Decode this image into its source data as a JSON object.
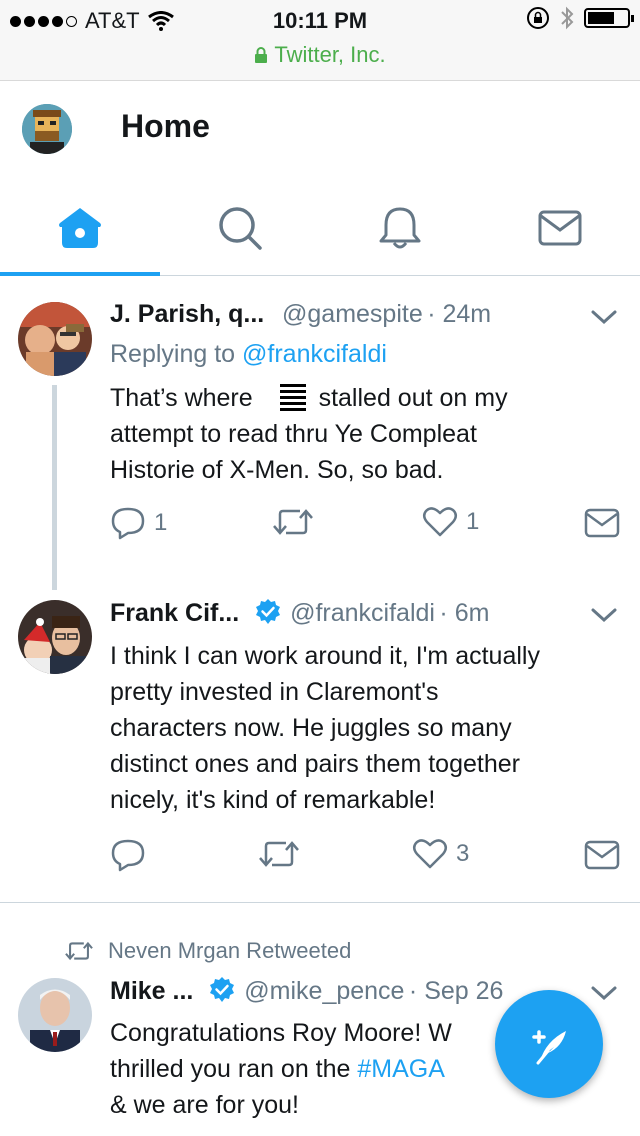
{
  "status_bar": {
    "carrier": "AT&T",
    "time": "10:11 PM",
    "url": "Twitter, Inc."
  },
  "header": {
    "title": "Home"
  },
  "tabs": [
    {
      "name": "home",
      "active": true
    },
    {
      "name": "search",
      "active": false
    },
    {
      "name": "notifications",
      "active": false
    },
    {
      "name": "messages",
      "active": false
    }
  ],
  "tweets": [
    {
      "name": "J. Parish, q...",
      "handle": "@gamespite",
      "time": "· 24m",
      "reply_prefix": "Replying to ",
      "reply_to": "@frankcifaldi",
      "text_line1a": "That’s where",
      "text_line1b": "stalled out on my",
      "text_line2": "attempt to read thru Ye Compleat",
      "text_line3": "Historie of X-Men. So, so bad.",
      "replies": "1",
      "retweets": "",
      "likes": "1"
    },
    {
      "name": "Frank Cif...",
      "handle": "@frankcifaldi",
      "time": "· 6m",
      "verified": true,
      "text_lines": [
        "I think I can work around it, I'm actually",
        "pretty invested in Claremont's",
        "characters now. He juggles so many",
        "distinct ones and pairs them together",
        "nicely, it's kind of remarkable!"
      ],
      "replies": "",
      "retweets": "",
      "likes": "3"
    },
    {
      "retweeted_by": "Neven Mrgan Retweeted",
      "name": "Mike ...",
      "handle": "@mike_pence",
      "time": "· Sep 26",
      "verified": true,
      "text_line1": "Congratulations Roy Moore! W",
      "text_line2a": "thrilled you ran on the ",
      "text_line2_link": "#MAGA",
      "text_line3": "& we are for you!"
    }
  ],
  "colors": {
    "accent": "#1da1f2",
    "secondary": "#657786",
    "verified": "#1da1f2"
  }
}
